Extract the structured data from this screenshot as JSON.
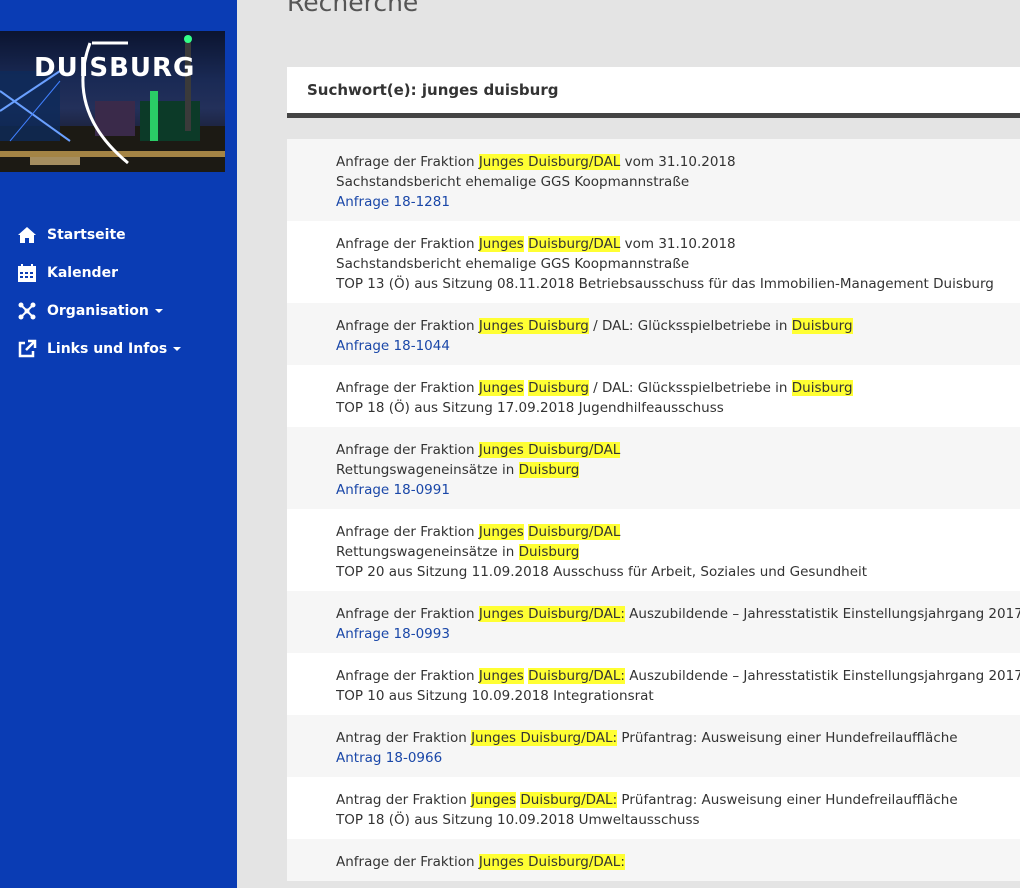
{
  "page": {
    "title": "Recherche"
  },
  "logo": {
    "text": "DUISBURG"
  },
  "nav": {
    "items": [
      {
        "label": "Startseite",
        "icon": "home-icon"
      },
      {
        "label": "Kalender",
        "icon": "calendar-icon"
      },
      {
        "label": "Organisation",
        "icon": "organisation-icon",
        "dropdown": true
      },
      {
        "label": "Links und Infos",
        "icon": "external-link-icon",
        "dropdown": true
      }
    ]
  },
  "search": {
    "label": "Suchwort(e): junges duisburg"
  },
  "results": [
    {
      "line1": [
        {
          "t": "Anfrage der Fraktion "
        },
        {
          "t": "Junges Duisburg/DAL",
          "h": true
        },
        {
          "t": " vom 31.10.2018"
        }
      ],
      "line2": [
        {
          "t": "Sachstandsbericht ehemalige GGS Koopmannstraße"
        }
      ],
      "line3": [
        {
          "t": "Anfrage 18-1281",
          "link": true
        }
      ]
    },
    {
      "line1": [
        {
          "t": "Anfrage der Fraktion "
        },
        {
          "t": "Junges",
          "h": true
        },
        {
          "t": " "
        },
        {
          "t": "Duisburg/DAL",
          "h": true
        },
        {
          "t": " vom 31.10.2018"
        }
      ],
      "line2": [
        {
          "t": "Sachstandsbericht ehemalige GGS Koopmannstraße"
        }
      ],
      "line3": [
        {
          "t": "TOP 13 (Ö)  aus Sitzung 08.11.2018 Betriebsausschuss für das Immobilien-Management Duisburg"
        }
      ]
    },
    {
      "line1": [
        {
          "t": "Anfrage der Fraktion "
        },
        {
          "t": "Junges Duisburg",
          "h": true
        },
        {
          "t": " / DAL: Glücksspielbetriebe in "
        },
        {
          "t": "Duisburg",
          "h": true
        }
      ],
      "line2": [
        {
          "t": "Anfrage 18-1044",
          "link": true
        }
      ]
    },
    {
      "line1": [
        {
          "t": "Anfrage der Fraktion "
        },
        {
          "t": "Junges",
          "h": true
        },
        {
          "t": " "
        },
        {
          "t": "Duisburg",
          "h": true
        },
        {
          "t": " / DAL: Glücksspielbetriebe in "
        },
        {
          "t": "Duisburg",
          "h": true
        }
      ],
      "line2": [
        {
          "t": "TOP 18 (Ö)  aus Sitzung 17.09.2018 Jugendhilfeausschuss"
        }
      ]
    },
    {
      "line1": [
        {
          "t": "Anfrage der Fraktion "
        },
        {
          "t": "Junges Duisburg/DAL",
          "h": true
        }
      ],
      "line2": [
        {
          "t": "Rettungswageneinsätze in "
        },
        {
          "t": "Duisburg",
          "h": true
        }
      ],
      "line3": [
        {
          "t": "Anfrage 18-0991",
          "link": true
        }
      ]
    },
    {
      "line1": [
        {
          "t": "Anfrage der Fraktion "
        },
        {
          "t": "Junges",
          "h": true
        },
        {
          "t": " "
        },
        {
          "t": "Duisburg/DAL",
          "h": true
        }
      ],
      "line2": [
        {
          "t": "Rettungswageneinsätze in "
        },
        {
          "t": "Duisburg",
          "h": true
        }
      ],
      "line3": [
        {
          "t": "TOP 20   aus Sitzung 11.09.2018 Ausschuss für Arbeit, Soziales und Gesundheit"
        }
      ]
    },
    {
      "line1": [
        {
          "t": "Anfrage der Fraktion "
        },
        {
          "t": "Junges Duisburg/DAL:",
          "h": true
        },
        {
          "t": " Auszubildende – Jahresstatistik Einstellungsjahrgang 2017"
        }
      ],
      "line2": [
        {
          "t": "Anfrage 18-0993",
          "link": true
        }
      ]
    },
    {
      "line1": [
        {
          "t": "Anfrage der Fraktion "
        },
        {
          "t": "Junges",
          "h": true
        },
        {
          "t": " "
        },
        {
          "t": "Duisburg/DAL:",
          "h": true
        },
        {
          "t": " Auszubildende – Jahresstatistik Einstellungsjahrgang 2017"
        }
      ],
      "line2": [
        {
          "t": "TOP 10   aus Sitzung 10.09.2018 Integrationsrat"
        }
      ]
    },
    {
      "line1": [
        {
          "t": "Antrag der Fraktion "
        },
        {
          "t": "Junges Duisburg/DAL:",
          "h": true
        },
        {
          "t": " Prüfantrag: Ausweisung einer Hundefreilauffläche"
        }
      ],
      "line2": [
        {
          "t": "Antrag 18-0966",
          "link": true
        }
      ]
    },
    {
      "line1": [
        {
          "t": "Antrag der Fraktion "
        },
        {
          "t": "Junges",
          "h": true
        },
        {
          "t": " "
        },
        {
          "t": "Duisburg/DAL:",
          "h": true
        },
        {
          "t": " Prüfantrag: Ausweisung einer Hundefreilauffläche"
        }
      ],
      "line2": [
        {
          "t": "TOP 18 (Ö)  aus Sitzung 10.09.2018 Umweltausschuss"
        }
      ]
    },
    {
      "line1": [
        {
          "t": "Anfrage der Fraktion "
        },
        {
          "t": "Junges Duisburg/DAL:",
          "h": true
        }
      ]
    }
  ]
}
